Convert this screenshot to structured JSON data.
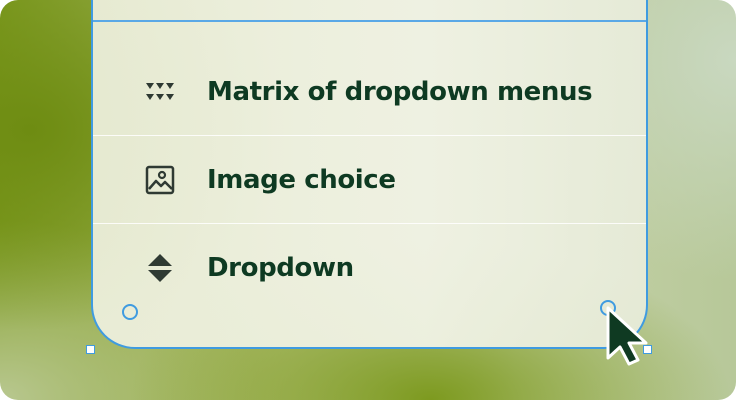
{
  "menu": {
    "items": [
      {
        "label": "Matrix of dropdown menus",
        "icon": "matrix-dropdown-icon"
      },
      {
        "label": "Image choice",
        "icon": "image-icon"
      },
      {
        "label": "Dropdown",
        "icon": "dropdown-sort-icon"
      }
    ]
  },
  "colors": {
    "selection": "#3f9be0",
    "label_text": "#0e3a22",
    "icon": "#2f3a33"
  },
  "cursor": {
    "icon": "arrow-cursor-icon"
  }
}
